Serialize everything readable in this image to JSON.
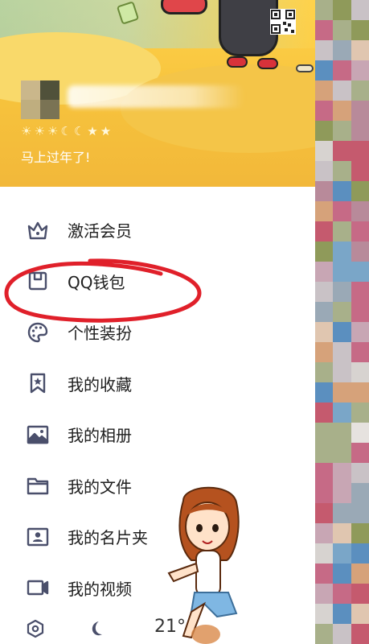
{
  "profile": {
    "level_icons": [
      "☀",
      "☀",
      "☀",
      "☾",
      "☾",
      "★",
      "★"
    ],
    "signature": "马上过年了!"
  },
  "menu": [
    {
      "label": "激活会员",
      "icon": "crown-icon"
    },
    {
      "label": "QQ钱包",
      "icon": "wallet-icon"
    },
    {
      "label": "个性装扮",
      "icon": "palette-icon"
    },
    {
      "label": "我的收藏",
      "icon": "bookmark-star-icon"
    },
    {
      "label": "我的相册",
      "icon": "image-icon"
    },
    {
      "label": "我的文件",
      "icon": "folder-icon"
    },
    {
      "label": "我的名片夹",
      "icon": "contact-card-icon"
    },
    {
      "label": "我的视频",
      "icon": "video-camera-icon"
    }
  ],
  "bottom_bar": {
    "settings_icon": "hexagon-settings-icon",
    "night_mode_icon": "moon-icon",
    "temperature": "21°"
  },
  "colors": {
    "icon_stroke": "#4a4f6b",
    "annotation": "#e0202a",
    "header_yellow": "#f6c23c"
  }
}
